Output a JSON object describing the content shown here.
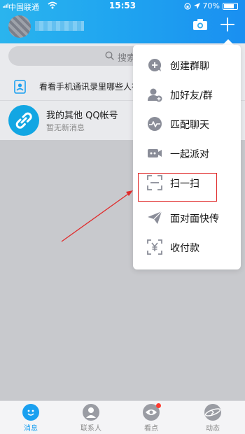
{
  "status_bar": {
    "carrier": "中国联通",
    "time": "15:53",
    "battery": "70%",
    "battery_level": 0.7
  },
  "search": {
    "placeholder": "搜索"
  },
  "contacts_prompt": "看看手机通讯录里哪些人在",
  "account": {
    "title": "我的其他 QQ帐号",
    "subtitle": "暂无新消息"
  },
  "menu": {
    "items": [
      {
        "label": "创建群聊",
        "icon": "chat-plus-icon"
      },
      {
        "label": "加好友/群",
        "icon": "add-friend-icon"
      },
      {
        "label": "匹配聊天",
        "icon": "match-chat-icon"
      },
      {
        "label": "一起派对",
        "icon": "party-icon"
      },
      {
        "label": "扫一扫",
        "icon": "scan-icon"
      },
      {
        "label": "面对面快传",
        "icon": "send-icon"
      },
      {
        "label": "收付款",
        "icon": "payment-icon"
      }
    ]
  },
  "tabs": [
    {
      "label": "消息",
      "active": true
    },
    {
      "label": "联系人"
    },
    {
      "label": "看点",
      "badge": true
    },
    {
      "label": "动态"
    }
  ],
  "colors": {
    "accent": "#1aa0f0",
    "highlight": "#e02b2b",
    "icon_gray": "#8a8d98"
  }
}
